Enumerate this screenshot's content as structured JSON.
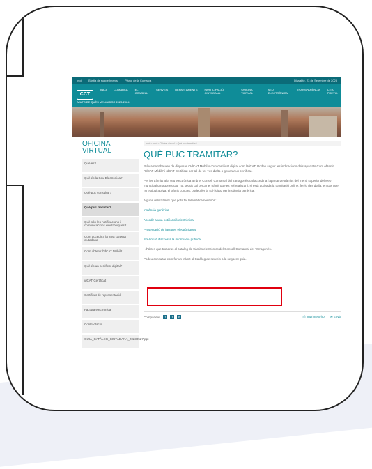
{
  "topbar": {
    "items": [
      "Inici",
      "Bústia de suggeriments",
      "Plànol de la Comarca"
    ],
    "date": "Dissabte, 23 de Setembre de 2023"
  },
  "nav": {
    "logo": "CCT",
    "items": [
      "INICI",
      "COMARCA",
      "EL CONSELL",
      "SERVEIS",
      "DEPARTAMENTS",
      "PARTICIPACIÓ CIUTADANA",
      "OFICINA VIRTUAL",
      "SEU ELECTRÒNICA",
      "TRANSPARÈNCIA",
      "CITA PRÈVIA"
    ],
    "active": "OFICINA VIRTUAL",
    "sub": "AJUTS DE QUÈS MENJADOR 2023-2024"
  },
  "sidebar": {
    "title_line1": "OFICINA",
    "title_line2": "VIRTUAL",
    "items": [
      "Què és?",
      "Què és la Seu Electrònica?",
      "Què puc consultar?",
      "Què puc tramitar?",
      "Què són les notificacions i comunicacions electròniques?",
      "Com accedir a la teva carpeta ciutadana",
      "Com obtenir l'idCAT Mòbil?",
      "Què és un certificat digital?",
      "idCAT Certificat",
      "Certificat de representació",
      "Factura electrònica",
      "Contractació",
      "GUIA_CATÀLEG_CIUTADANA_20230527.ppt"
    ],
    "active_index": 3
  },
  "main": {
    "breadcrumb": "Inici  >  Inici  >  Oficina virtual  >  Què puc tramitar?",
    "title": "QUÈ PUC TRAMITAR?",
    "p1": "Prèviament haureu de disposar d'IdCAT Mòbil o d'un certificat digital com l'IdCAT. Podeu seguir les indicacions dels apartats Com obtenir l'IdCAT Mòbil? i IdCAT Certificat per tal de fer-vos d'alta o generar un certificat.",
    "p2": "Per fer tràmits a la seu electrònica amb el Consell Comarcal del Tarragonès cal accedir a l'apartat de tràmits del menú superior del web municipal tarragones.cat. Tot seguit cal cercar el tràmit que es vol realitzar i, si està activada la tramitació online, fer-lo des d'allà; en cas que no estigui activat el tràmit concret, podeu fer la sol·licitud per instància genèrica.",
    "p3": "Alguns dels tràmits que pots fer telemàticament són:",
    "links": [
      "Instància genèrica",
      "Accedir a una notificació electrònica",
      "Presentació de factures electròniques",
      "Sol·licitud d'accés a la informació pública"
    ],
    "p4": "I d'altres que trobaràs al catàleg de tràmits electrònics del Consell Comarcal del Tarragonès.",
    "p5": "Podeu consultar com fer un tràmit al Catàleg de serveis a la següent guia.",
    "share_label": "Comparteix:",
    "share_icons": [
      "facebook-icon",
      "twitter-icon",
      "linkedin-icon"
    ],
    "print_label": "Imprimeix-ho",
    "send_label": "Envia"
  }
}
